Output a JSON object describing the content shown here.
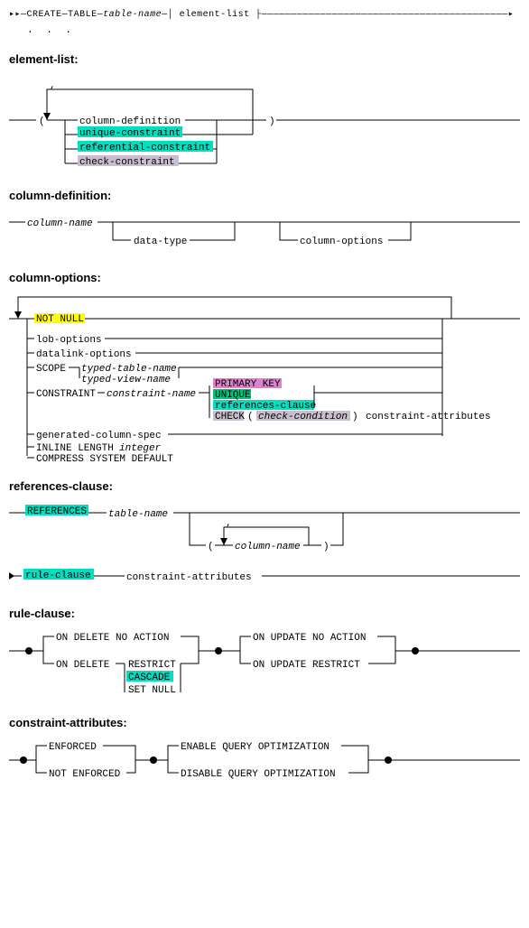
{
  "header": {
    "create": "CREATE",
    "table": "TABLE",
    "table_name": "table-name",
    "element_list": "element-list"
  },
  "sections": {
    "element_list": "element-list:",
    "column_definition": "column-definition:",
    "column_options": "column-options:",
    "references_clause": "references-clause:",
    "rule_clause": "rule-clause:",
    "constraint_attributes": "constraint-attributes:"
  },
  "element_list": {
    "column_definition": "column-definition",
    "unique_constraint": "unique-constraint",
    "referential_constraint": "referential-constraint",
    "check_constraint": "check-constraint",
    "lparen": "(",
    "rparen": ")",
    "comma": ","
  },
  "column_definition": {
    "column_name": "column-name",
    "data_type": "data-type",
    "column_options": "column-options"
  },
  "column_options": {
    "not_null": "NOT NULL",
    "lob_options": "lob-options",
    "datalink_options": "datalink-options",
    "scope": "SCOPE",
    "typed_table_name": "typed-table-name",
    "typed_view_name": "typed-view-name",
    "constraint": "CONSTRAINT",
    "constraint_name": "constraint-name",
    "primary_key": "PRIMARY KEY",
    "unique": "UNIQUE",
    "references_clause": "references-clause",
    "check": "CHECK",
    "lparen": "(",
    "check_condition": "check-condition",
    "rparen": ")",
    "constraint_attributes": "constraint-attributes",
    "generated_column_spec": "generated-column-spec",
    "inline_length": "INLINE LENGTH",
    "integer": "integer",
    "compress_system_default": "COMPRESS SYSTEM DEFAULT"
  },
  "references_clause": {
    "references": "REFERENCES",
    "table_name": "table-name",
    "lparen": "(",
    "column_name": "column-name",
    "rparen": ")",
    "comma": ",",
    "rule_clause": "rule-clause",
    "constraint_attributes": "constraint-attributes"
  },
  "rule_clause": {
    "on_delete_no_action": "ON DELETE NO ACTION",
    "on_delete": "ON DELETE",
    "restrict": "RESTRICT",
    "cascade": "CASCADE",
    "set_null": "SET NULL",
    "on_update_no_action": "ON UPDATE NO ACTION",
    "on_update_restrict": "ON UPDATE RESTRICT"
  },
  "constraint_attributes": {
    "enforced": "ENFORCED",
    "not_enforced": "NOT ENFORCED",
    "enable_query_optimization": "ENABLE QUERY OPTIMIZATION",
    "disable_query_optimization": "DISABLE QUERY OPTIMIZATION"
  }
}
